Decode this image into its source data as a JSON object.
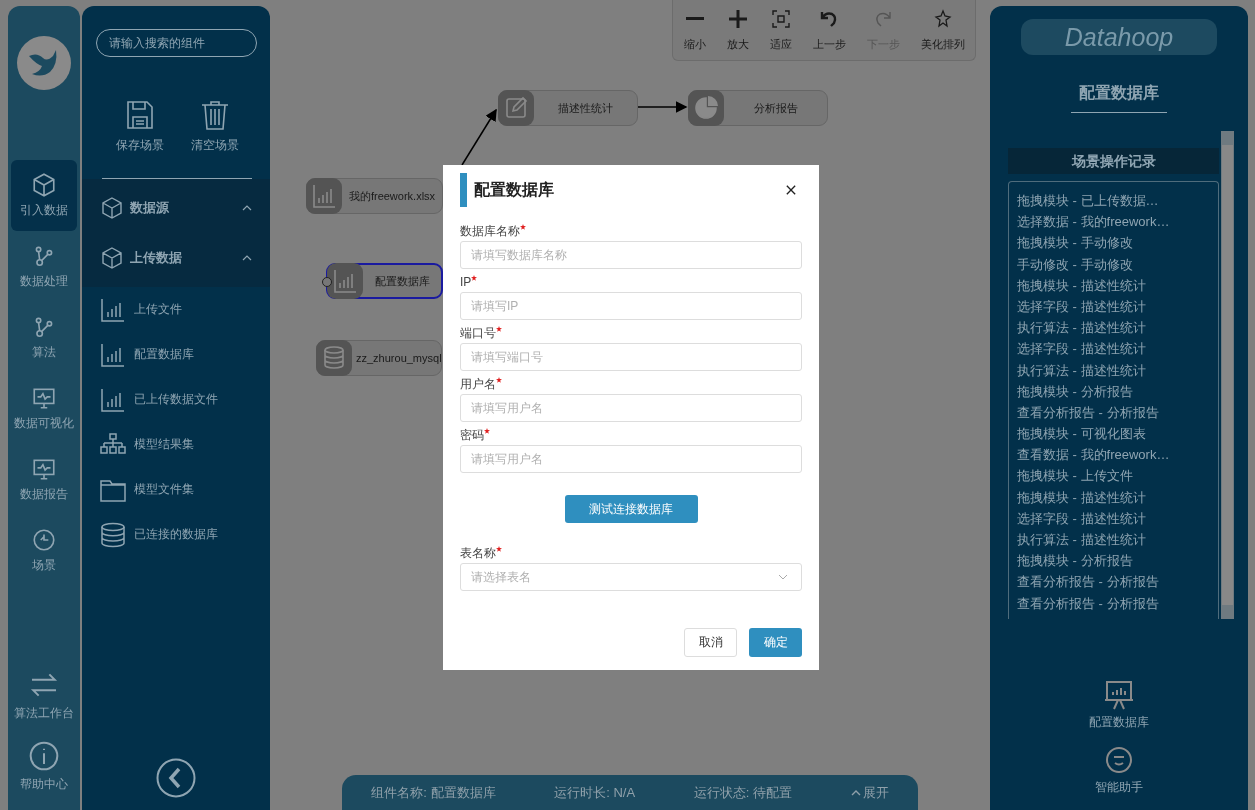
{
  "rail": {
    "items": [
      {
        "label": "引入数据",
        "selected": true
      },
      {
        "label": "数据处理",
        "selected": false
      },
      {
        "label": "算法",
        "selected": false
      },
      {
        "label": "数据可视化",
        "selected": false
      },
      {
        "label": "数据报告",
        "selected": false
      },
      {
        "label": "场景",
        "selected": false
      }
    ],
    "bottom_items": [
      {
        "label": "算法工作台"
      },
      {
        "label": "帮助中心"
      }
    ]
  },
  "panel": {
    "search": {
      "placeholder": "请输入搜索的组件"
    },
    "actions": [
      {
        "label": "保存场景"
      },
      {
        "label": "清空场景"
      }
    ],
    "categories": [
      {
        "label": "数据源",
        "expanded": true
      },
      {
        "label": "上传数据",
        "expanded": true
      }
    ],
    "items": [
      {
        "label": "上传文件"
      },
      {
        "label": "配置数据库"
      },
      {
        "label": "已上传数据文件"
      },
      {
        "label": "模型结果集"
      },
      {
        "label": "模型文件集"
      },
      {
        "label": "已连接的数据库"
      }
    ]
  },
  "toolbar": [
    {
      "label": "缩小",
      "disabled": false
    },
    {
      "label": "放大",
      "disabled": false
    },
    {
      "label": "适应",
      "disabled": false
    },
    {
      "label": "上一步",
      "disabled": false
    },
    {
      "label": "下一步",
      "disabled": true
    },
    {
      "label": "美化排列",
      "disabled": false
    }
  ],
  "canvas": {
    "nodes": [
      {
        "label": "描述性统计",
        "selected": false
      },
      {
        "label": "分析报告",
        "selected": false
      },
      {
        "label": "我的freework.xlsx",
        "selected": false
      },
      {
        "label": "配置数据库",
        "selected": true
      },
      {
        "label": "zz_zhurou_mysql",
        "selected": false
      }
    ]
  },
  "status_bar": {
    "items": [
      "组件名称: 配置数据库",
      "运行时长: N/A",
      "运行状态: 待配置"
    ],
    "expand": "展开"
  },
  "dialog": {
    "title": "配置数据库",
    "fields": [
      {
        "label": "数据库名称",
        "required": true,
        "placeholder": "请填写数据库名称",
        "kind": "input"
      },
      {
        "label": "IP",
        "required": true,
        "placeholder": "请填写IP",
        "kind": "input"
      },
      {
        "label": "端口号",
        "required": true,
        "placeholder": "请填写端口号",
        "kind": "input"
      },
      {
        "label": "用户名",
        "required": true,
        "placeholder": "请填写用户名",
        "kind": "input"
      },
      {
        "label": "密码",
        "required": true,
        "placeholder": "请填写用户名",
        "kind": "input"
      },
      {
        "label": "表名称",
        "required": true,
        "placeholder": "请选择表名",
        "kind": "select"
      }
    ],
    "test_button": "测试连接数据库",
    "cancel": "取消",
    "ok": "确定"
  },
  "right": {
    "logo": "Datahoop",
    "title": "配置数据库",
    "log_title": "场景操作记录",
    "log": [
      "拖拽模块 - 已上传数据…",
      "选择数据 - 我的freework…",
      "拖拽模块 - 手动修改",
      "手动修改 - 手动修改",
      "拖拽模块 - 描述性统计",
      "选择字段 - 描述性统计",
      "执行算法 - 描述性统计",
      "选择字段 - 描述性统计",
      "执行算法 - 描述性统计",
      "拖拽模块 - 分析报告",
      "查看分析报告 - 分析报告",
      "拖拽模块 - 可视化图表",
      "查看数据 - 我的freework…",
      "拖拽模块 - 上传文件",
      "拖拽模块 - 描述性统计",
      "选择字段 - 描述性统计",
      "执行算法 - 描述性统计",
      "拖拽模块 - 分析报告",
      "查看分析报告 - 分析报告",
      "查看分析报告 - 分析报告"
    ],
    "actions": [
      {
        "label": "配置数据库"
      },
      {
        "label": "智能助手"
      }
    ]
  }
}
